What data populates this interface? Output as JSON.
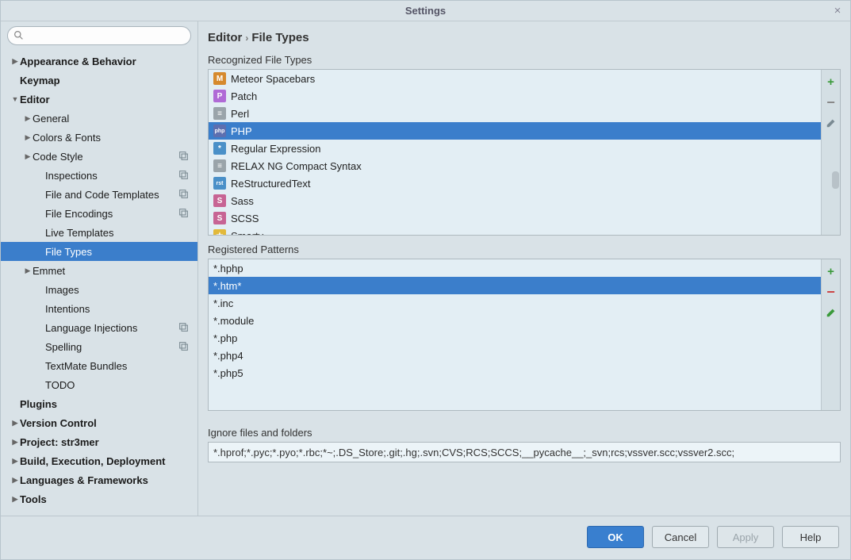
{
  "window": {
    "title": "Settings"
  },
  "search": {
    "placeholder": ""
  },
  "breadcrumb": {
    "a": "Editor",
    "b": "File Types"
  },
  "sidebar": [
    {
      "label": "Appearance & Behavior",
      "depth": 0,
      "expandable": true,
      "expanded": false,
      "selected": false,
      "badge": false
    },
    {
      "label": "Keymap",
      "depth": 0,
      "expandable": false,
      "expanded": false,
      "selected": false,
      "badge": false
    },
    {
      "label": "Editor",
      "depth": 0,
      "expandable": true,
      "expanded": true,
      "selected": false,
      "badge": false
    },
    {
      "label": "General",
      "depth": 1,
      "expandable": true,
      "expanded": false,
      "selected": false,
      "badge": false
    },
    {
      "label": "Colors & Fonts",
      "depth": 1,
      "expandable": true,
      "expanded": false,
      "selected": false,
      "badge": false
    },
    {
      "label": "Code Style",
      "depth": 1,
      "expandable": true,
      "expanded": false,
      "selected": false,
      "badge": true
    },
    {
      "label": "Inspections",
      "depth": 2,
      "expandable": false,
      "expanded": false,
      "selected": false,
      "badge": true
    },
    {
      "label": "File and Code Templates",
      "depth": 2,
      "expandable": false,
      "expanded": false,
      "selected": false,
      "badge": true
    },
    {
      "label": "File Encodings",
      "depth": 2,
      "expandable": false,
      "expanded": false,
      "selected": false,
      "badge": true
    },
    {
      "label": "Live Templates",
      "depth": 2,
      "expandable": false,
      "expanded": false,
      "selected": false,
      "badge": false
    },
    {
      "label": "File Types",
      "depth": 2,
      "expandable": false,
      "expanded": false,
      "selected": true,
      "badge": false
    },
    {
      "label": "Emmet",
      "depth": 1,
      "expandable": true,
      "expanded": false,
      "selected": false,
      "badge": false
    },
    {
      "label": "Images",
      "depth": 2,
      "expandable": false,
      "expanded": false,
      "selected": false,
      "badge": false
    },
    {
      "label": "Intentions",
      "depth": 2,
      "expandable": false,
      "expanded": false,
      "selected": false,
      "badge": false
    },
    {
      "label": "Language Injections",
      "depth": 2,
      "expandable": false,
      "expanded": false,
      "selected": false,
      "badge": true
    },
    {
      "label": "Spelling",
      "depth": 2,
      "expandable": false,
      "expanded": false,
      "selected": false,
      "badge": true
    },
    {
      "label": "TextMate Bundles",
      "depth": 2,
      "expandable": false,
      "expanded": false,
      "selected": false,
      "badge": false
    },
    {
      "label": "TODO",
      "depth": 2,
      "expandable": false,
      "expanded": false,
      "selected": false,
      "badge": false
    },
    {
      "label": "Plugins",
      "depth": 0,
      "expandable": false,
      "expanded": false,
      "selected": false,
      "badge": false
    },
    {
      "label": "Version Control",
      "depth": 0,
      "expandable": true,
      "expanded": false,
      "selected": false,
      "badge": false
    },
    {
      "label": "Project: str3mer",
      "depth": 0,
      "expandable": true,
      "expanded": false,
      "selected": false,
      "badge": false
    },
    {
      "label": "Build, Execution, Deployment",
      "depth": 0,
      "expandable": true,
      "expanded": false,
      "selected": false,
      "badge": false
    },
    {
      "label": "Languages & Frameworks",
      "depth": 0,
      "expandable": true,
      "expanded": false,
      "selected": false,
      "badge": false
    },
    {
      "label": "Tools",
      "depth": 0,
      "expandable": true,
      "expanded": false,
      "selected": false,
      "badge": false
    }
  ],
  "sections": {
    "recognized_label": "Recognized File Types",
    "patterns_label": "Registered Patterns",
    "ignore_label": "Ignore files and folders"
  },
  "file_types": [
    {
      "label": "Meteor Spacebars",
      "selected": false,
      "icon_bg": "#d68a2e",
      "icon_txt": "M"
    },
    {
      "label": "Patch",
      "selected": false,
      "icon_bg": "#b06ad6",
      "icon_txt": "P"
    },
    {
      "label": "Perl",
      "selected": false,
      "icon_bg": "#9aa4aa",
      "icon_txt": "≡"
    },
    {
      "label": "PHP",
      "selected": true,
      "icon_bg": "#5d6fb0",
      "icon_txt": "php"
    },
    {
      "label": "Regular Expression",
      "selected": false,
      "icon_bg": "#4a90c8",
      "icon_txt": "*"
    },
    {
      "label": "RELAX NG Compact Syntax",
      "selected": false,
      "icon_bg": "#9aa4aa",
      "icon_txt": "≡"
    },
    {
      "label": "ReStructuredText",
      "selected": false,
      "icon_bg": "#4a90c8",
      "icon_txt": "rst"
    },
    {
      "label": "Sass",
      "selected": false,
      "icon_bg": "#c76494",
      "icon_txt": "S"
    },
    {
      "label": "SCSS",
      "selected": false,
      "icon_bg": "#c76494",
      "icon_txt": "S"
    },
    {
      "label": "Smarty",
      "selected": false,
      "icon_bg": "#e2b93a",
      "icon_txt": "★"
    }
  ],
  "patterns": [
    {
      "label": "*.hphp",
      "selected": false
    },
    {
      "label": "*.htm*",
      "selected": true
    },
    {
      "label": "*.inc",
      "selected": false
    },
    {
      "label": "*.module",
      "selected": false
    },
    {
      "label": "*.php",
      "selected": false
    },
    {
      "label": "*.php4",
      "selected": false
    },
    {
      "label": "*.php5",
      "selected": false
    }
  ],
  "ignore": {
    "value": "*.hprof;*.pyc;*.pyo;*.rbc;*~;.DS_Store;.git;.hg;.svn;CVS;RCS;SCCS;__pycache__;_svn;rcs;vssver.scc;vssver2.scc;"
  },
  "buttons": {
    "ok": "OK",
    "cancel": "Cancel",
    "apply": "Apply",
    "help": "Help"
  }
}
